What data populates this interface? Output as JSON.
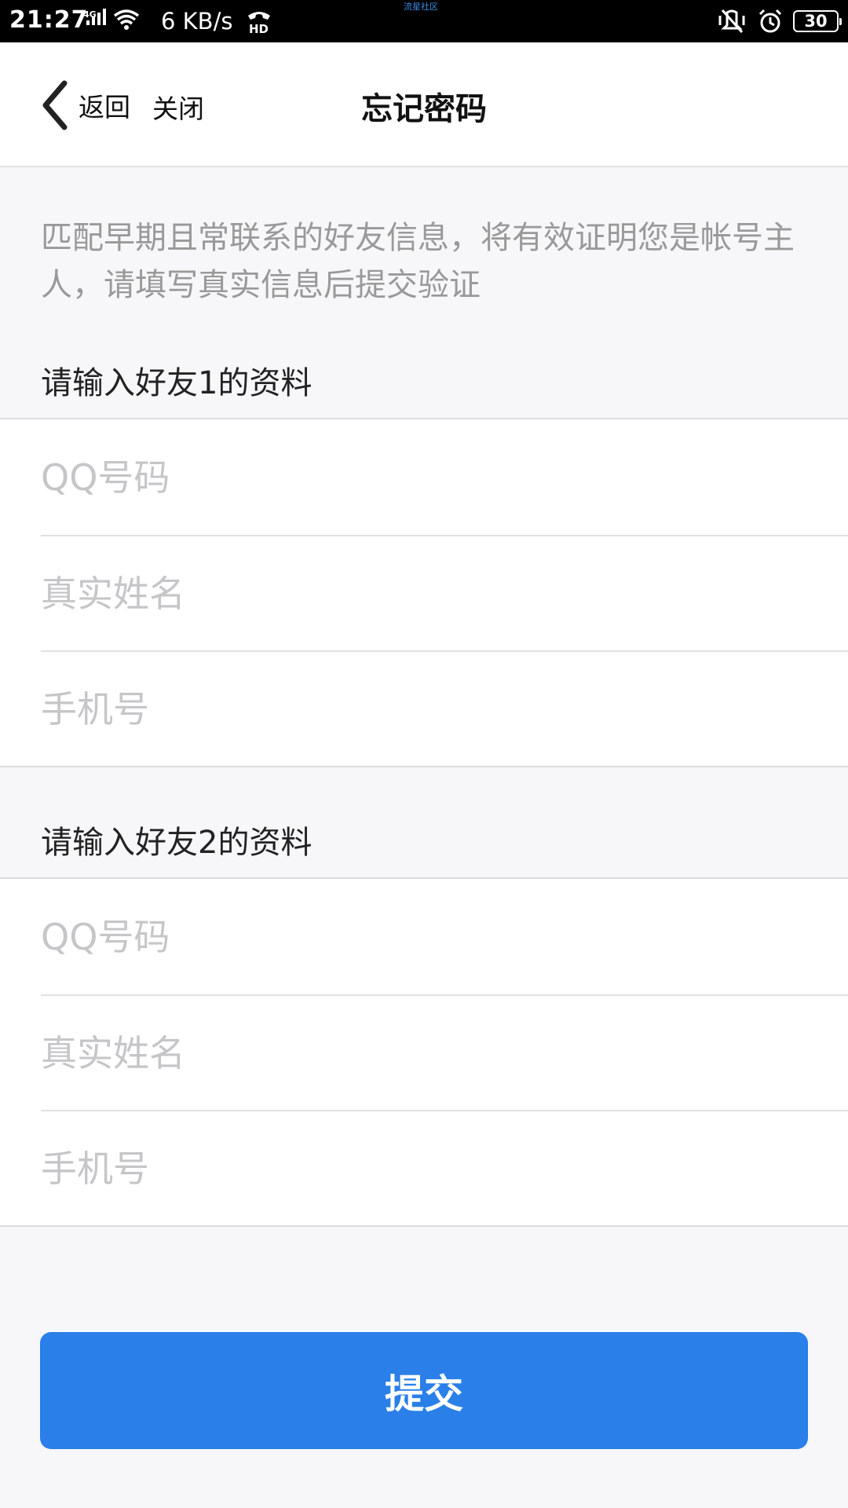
{
  "status_bar": {
    "time": "21:27",
    "network_type": "4G",
    "speed": "6 KB/s",
    "hd": "HD",
    "center_text": "流星社区",
    "battery": "30"
  },
  "nav": {
    "back_label": "返回",
    "close_label": "关闭",
    "title": "忘记密码"
  },
  "description": "匹配早期且常联系的好友信息，将有效证明您是帐号主人，请填写真实信息后提交验证",
  "friend1": {
    "title": "请输入好友1的资料",
    "qq_placeholder": "QQ号码",
    "name_placeholder": "真实姓名",
    "phone_placeholder": "手机号"
  },
  "friend2": {
    "title": "请输入好友2的资料",
    "qq_placeholder": "QQ号码",
    "name_placeholder": "真实姓名",
    "phone_placeholder": "手机号"
  },
  "submit_label": "提交",
  "colors": {
    "accent": "#2a7fe8",
    "background": "#f7f7f9",
    "placeholder": "#c6c6c8",
    "description": "#999999"
  }
}
